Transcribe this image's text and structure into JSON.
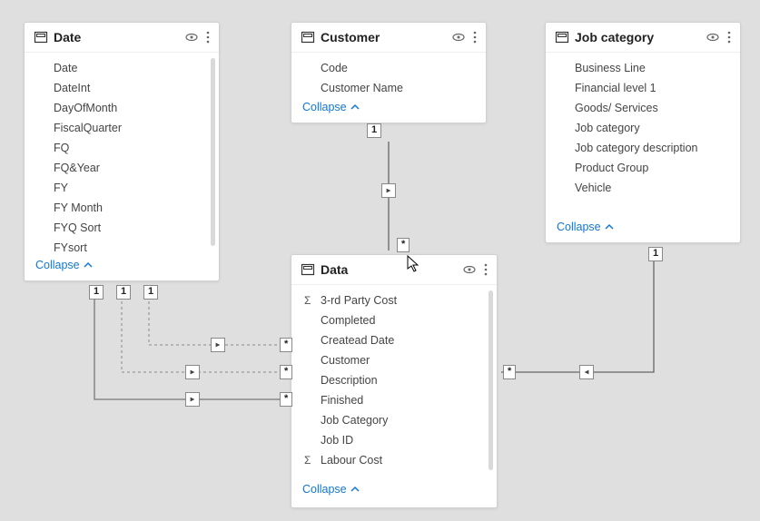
{
  "tables": {
    "date": {
      "title": "Date",
      "fields": [
        "Date",
        "DateInt",
        "DayOfMonth",
        "FiscalQuarter",
        "FQ",
        "FQ&Year",
        "FY",
        "FY Month",
        "FYQ Sort",
        "FYsort"
      ],
      "collapse": "Collapse"
    },
    "customer": {
      "title": "Customer",
      "fields": [
        "Code",
        "Customer Name"
      ],
      "collapse": "Collapse"
    },
    "job": {
      "title": "Job category",
      "fields": [
        "Business Line",
        "Financial level 1",
        "Goods/ Services",
        "Job category",
        "Job category description",
        "Product Group",
        "Vehicle"
      ],
      "collapse": "Collapse"
    },
    "data": {
      "title": "Data",
      "fields": [
        {
          "label": "3-rd Party Cost",
          "agg": true
        },
        {
          "label": "Completed"
        },
        {
          "label": "Createad Date"
        },
        {
          "label": "Customer"
        },
        {
          "label": "Description"
        },
        {
          "label": "Finished"
        },
        {
          "label": "Job Category"
        },
        {
          "label": "Job ID"
        },
        {
          "label": "Labour Cost",
          "agg": true
        }
      ],
      "collapse": "Collapse"
    }
  },
  "relationships": [
    {
      "from": "customer",
      "to": "data",
      "from_card": "1",
      "to_card": "*"
    },
    {
      "from": "date",
      "to": "data",
      "from_card": "1",
      "to_card": "*",
      "multi": 3
    },
    {
      "from": "job",
      "to": "data",
      "from_card": "1",
      "to_card": "*"
    }
  ],
  "cardinality": {
    "cust_one": "1",
    "data_from_cust": "*",
    "date_a": "1",
    "date_b": "1",
    "date_c": "1",
    "data_from_date_a": "*",
    "data_from_date_b": "*",
    "data_from_date_c": "*",
    "job_one": "1",
    "data_from_job": "*"
  }
}
